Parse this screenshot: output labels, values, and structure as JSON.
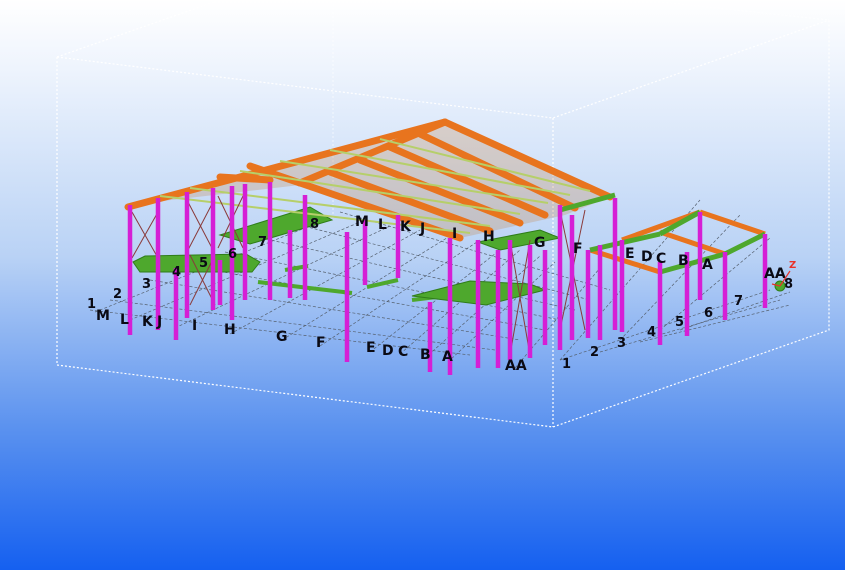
{
  "viewport": {
    "description_colors": {
      "column": "#d51fd5",
      "rafter": "#e8741e",
      "beam": "#4ea82d",
      "purlin": "#b6cf6a",
      "bracing": "#8a3a3a",
      "grid": "#5a6470",
      "boundary": "#ffffff"
    }
  },
  "grid_labels": {
    "left_front_letters": [
      "M",
      "L",
      "K",
      "J",
      "I",
      "H",
      "G",
      "F",
      "E",
      "D",
      "C",
      "B",
      "A",
      "AA"
    ],
    "left_side_numbers": [
      "1",
      "2",
      "3",
      "4",
      "5",
      "6",
      "7",
      "8"
    ],
    "top_letters": [
      "M",
      "L",
      "K",
      "J",
      "I",
      "H",
      "G",
      "F"
    ],
    "right_letters": [
      "E",
      "D",
      "C",
      "B",
      "A",
      "AA"
    ],
    "right_numbers": [
      "1",
      "2",
      "3",
      "4",
      "5",
      "6",
      "7",
      "8"
    ]
  },
  "axis_indicator": {
    "z_label": "Z"
  }
}
